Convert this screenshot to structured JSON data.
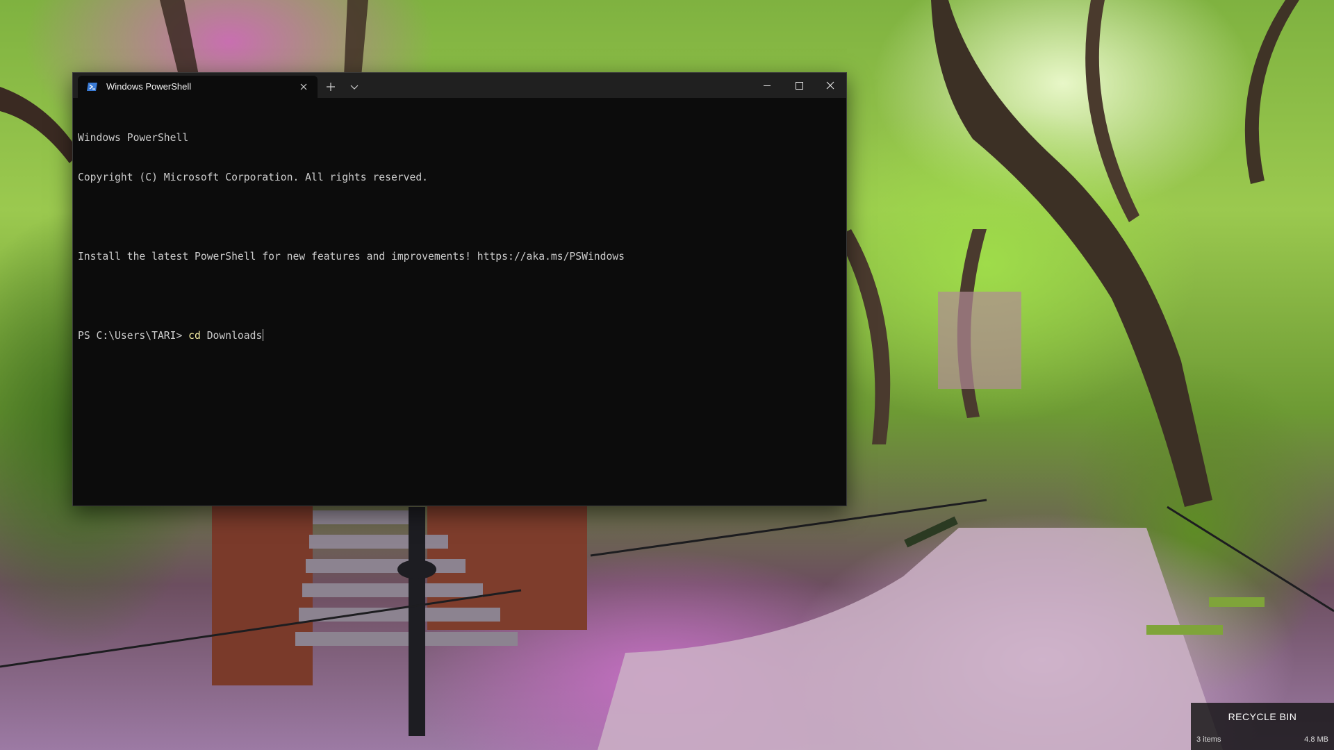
{
  "desktop": {
    "wallpaper_icon": "park-wallpaper"
  },
  "terminal": {
    "tab": {
      "title": "Windows PowerShell",
      "icon": "powershell-icon",
      "close_icon": "close-icon"
    },
    "new_tab_icon": "plus-icon",
    "dropdown_icon": "chevron-down-icon",
    "window_controls": {
      "minimize_icon": "minimize-icon",
      "maximize_icon": "maximize-icon",
      "close_icon": "close-icon"
    },
    "console": {
      "lines": [
        "Windows PowerShell",
        "Copyright (C) Microsoft Corporation. All rights reserved.",
        "",
        "Install the latest PowerShell for new features and improvements! https://aka.ms/PSWindows",
        ""
      ],
      "prompt": "PS C:\\Users\\TARI> ",
      "command": "cd",
      "argument": " Downloads"
    },
    "colors": {
      "background": "#0c0c0c",
      "text": "#cccccc",
      "command": "#f9f1a5",
      "titlebar": "#202020",
      "powershell_icon": "#3a7bd5"
    }
  },
  "recycle_bin": {
    "title": "RECYCLE BIN",
    "items": "3 items",
    "size": "4.8 MB"
  }
}
